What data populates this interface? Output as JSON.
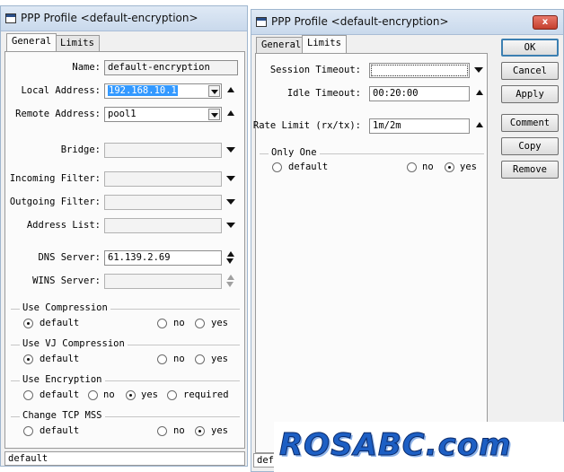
{
  "left_window": {
    "title": "PPP Profile <default-encryption>",
    "tabs": [
      "General",
      "Limits"
    ],
    "fields": {
      "name": {
        "label": "Name:",
        "value": "default-encryption"
      },
      "local_address": {
        "label": "Local Address:",
        "value": "192.168.10.1"
      },
      "remote_address": {
        "label": "Remote Address:",
        "value": "pool1"
      },
      "bridge": {
        "label": "Bridge:",
        "value": ""
      },
      "incoming_filter": {
        "label": "Incoming Filter:",
        "value": ""
      },
      "outgoing_filter": {
        "label": "Outgoing Filter:",
        "value": ""
      },
      "address_list": {
        "label": "Address List:",
        "value": ""
      },
      "dns_server": {
        "label": "DNS Server:",
        "value": "61.139.2.69"
      },
      "wins_server": {
        "label": "WINS Server:",
        "value": ""
      }
    },
    "use_compression": {
      "title": "Use Compression",
      "options": [
        "default",
        "no",
        "yes"
      ],
      "selected": "default"
    },
    "use_vj_compression": {
      "title": "Use VJ Compression",
      "options": [
        "default",
        "no",
        "yes"
      ],
      "selected": "default"
    },
    "use_encryption": {
      "title": "Use Encryption",
      "options": [
        "default",
        "no",
        "yes",
        "required"
      ],
      "selected": "yes"
    },
    "change_tcp_mss": {
      "title": "Change TCP MSS",
      "options": [
        "default",
        "no",
        "yes"
      ],
      "selected": "yes"
    },
    "status": "default"
  },
  "right_window": {
    "title": "PPP Profile <default-encryption>",
    "close_icon_label": "x",
    "tabs": [
      "General",
      "Limits"
    ],
    "session_timeout": {
      "label": "Session Timeout:",
      "value": ""
    },
    "idle_timeout": {
      "label": "Idle Timeout:",
      "value": "00:20:00"
    },
    "rate_limit": {
      "label": "Rate Limit (rx/tx):",
      "value": "1m/2m"
    },
    "only_one": {
      "title": "Only One",
      "options": [
        "default",
        "no",
        "yes"
      ],
      "selected": "yes"
    },
    "buttons": [
      "OK",
      "Cancel",
      "Apply",
      "Comment",
      "Copy",
      "Remove"
    ],
    "status": "def"
  },
  "watermark": "ROSABC.com"
}
